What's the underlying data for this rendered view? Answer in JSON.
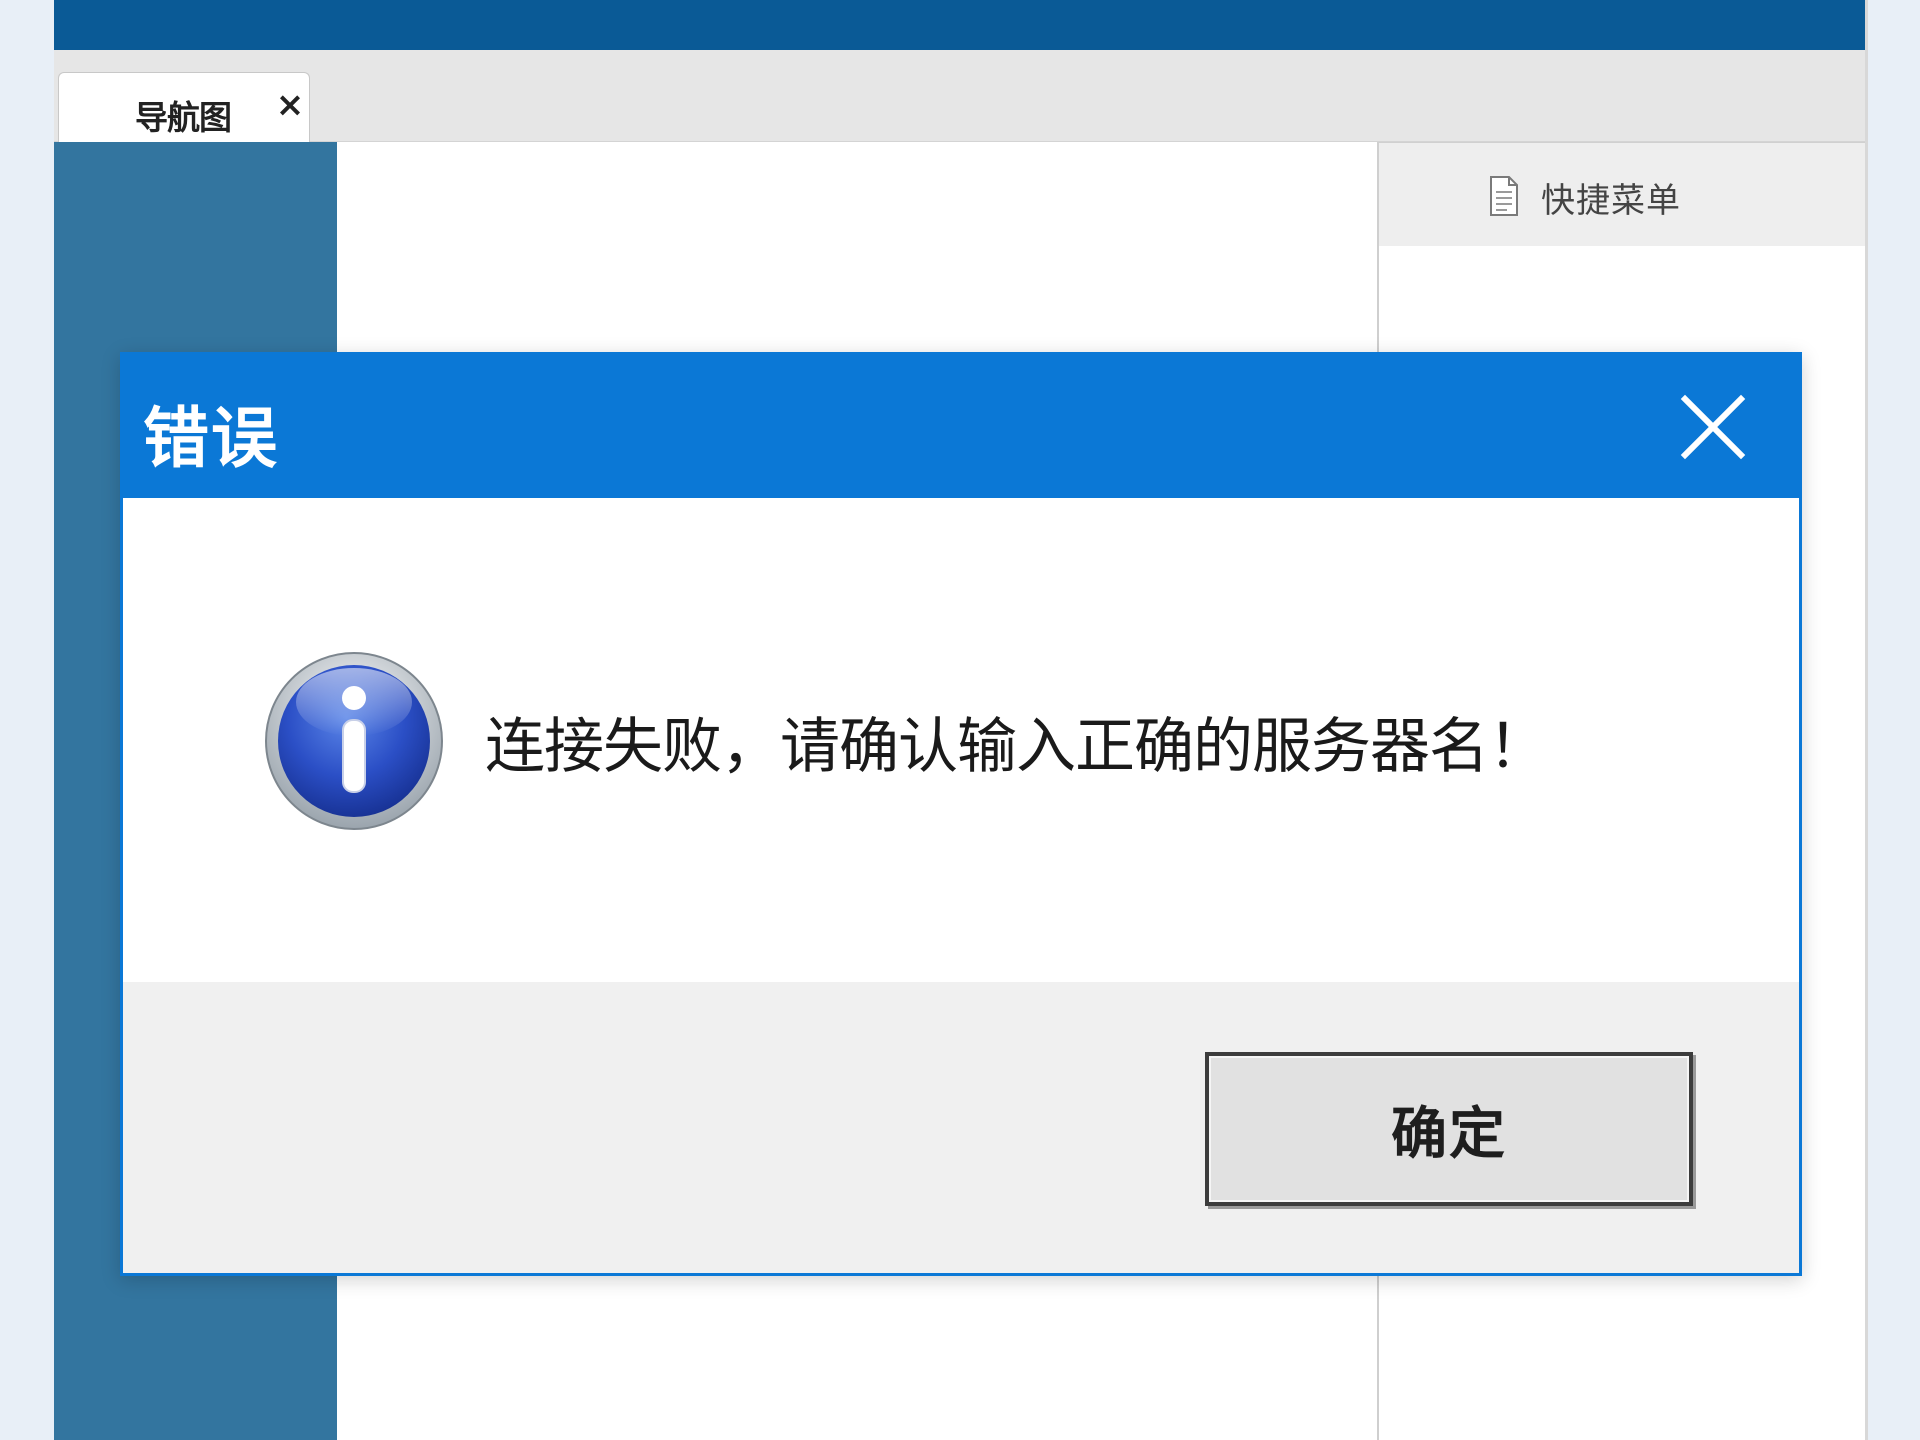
{
  "app": {
    "tab_label": "导航图",
    "tab_close": "×"
  },
  "right_panel": {
    "title": "快捷菜单",
    "icon": "document-icon"
  },
  "dialog": {
    "title": "错误",
    "icon": "info-icon",
    "message": "连接失败，请确认输入正确的服务器名！",
    "ok_label": "确定"
  },
  "colors": {
    "top_bar": "#0a5a96",
    "sidebar": "#33759f",
    "dialog_titlebar": "#0b78d6",
    "dialog_footer": "#f0f0f0"
  }
}
